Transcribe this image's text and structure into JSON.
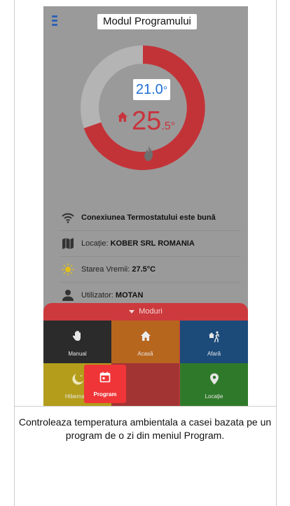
{
  "header": {
    "title": "Modul Programului"
  },
  "thermostat": {
    "set_temp": "21.0",
    "set_unit": "°",
    "room_temp_int": "25",
    "room_temp_dec": ".5°"
  },
  "info": {
    "connection": "Conexiunea Termostatului este bună",
    "location_label": "Locație: ",
    "location_value": "KOBER SRL ROMANIA",
    "weather_label": "Starea Vremii: ",
    "weather_value": "27.5°C",
    "user_label": "Utilizator: ",
    "user_value": "MOTAN"
  },
  "modes": {
    "header": "Moduri",
    "items": [
      {
        "label": "Manual",
        "icon": "hand-icon"
      },
      {
        "label": "Acasă",
        "icon": "home-icon"
      },
      {
        "label": "Afară",
        "icon": "walk-out-icon"
      },
      {
        "label": "Hibernare",
        "icon": "moon-icon"
      },
      {
        "label": "Program",
        "icon": "calendar-icon"
      },
      {
        "label": "Locație",
        "icon": "location-pin-icon"
      }
    ],
    "active": "Program"
  },
  "caption": "Controleaza temperatura ambientala a casei bazata pe un program de o zi din meniul Program.",
  "colors": {
    "accent_red": "#cc3a3e",
    "accent_blue": "#1f6fd4",
    "overlay_gray": "#9a9a9a"
  }
}
